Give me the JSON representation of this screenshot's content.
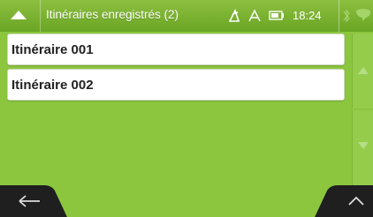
{
  "header": {
    "title": "Itinéraires enregistrés (2)",
    "time": "18:24",
    "icons": [
      "chevron-up-icon",
      "satellite-icon",
      "gps-icon",
      "battery-icon",
      "bluetooth-icon",
      "message-icon"
    ]
  },
  "routes": [
    {
      "label": "Itinéraire 001"
    },
    {
      "label": "Itinéraire 002"
    }
  ],
  "scroll": {
    "up_icon": "arrow-up-icon",
    "down_icon": "arrow-down-icon"
  },
  "footer": {
    "back_icon": "back-arrow-icon",
    "up_icon": "chevron-up-icon"
  },
  "colors": {
    "accent": "#8cc63f",
    "bar": "#1a1a1a",
    "item_bg": "#ffffff"
  }
}
